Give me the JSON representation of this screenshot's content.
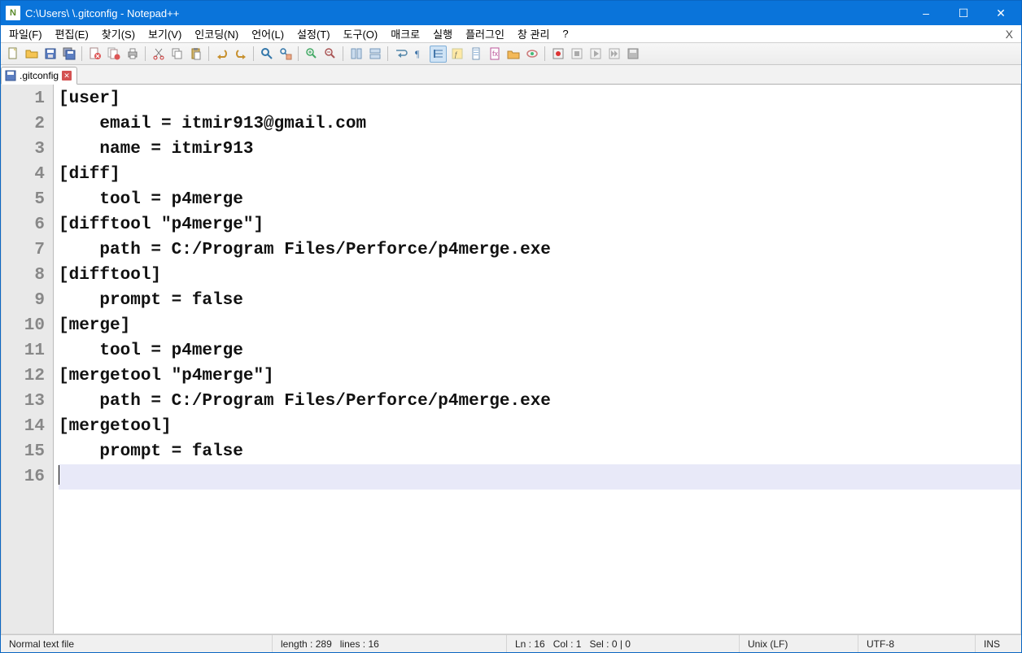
{
  "window": {
    "title": "C:\\Users\\          \\.gitconfig - Notepad++",
    "app_icon_letter": "N"
  },
  "win_controls": {
    "min": "–",
    "max": "☐",
    "close": "✕"
  },
  "menu": {
    "items": [
      "파일(F)",
      "편집(E)",
      "찾기(S)",
      "보기(V)",
      "인코딩(N)",
      "언어(L)",
      "설정(T)",
      "도구(O)",
      "매크로",
      "실행",
      "플러그인",
      "창 관리",
      "?"
    ],
    "close_x": "X"
  },
  "tab": {
    "filename": ".gitconfig"
  },
  "editor": {
    "lines": [
      "[user]",
      "    email = itmir913@gmail.com",
      "    name = itmir913",
      "[diff]",
      "    tool = p4merge",
      "[difftool \"p4merge\"]",
      "    path = C:/Program Files/Perforce/p4merge.exe",
      "[difftool]",
      "    prompt = false",
      "[merge]",
      "    tool = p4merge",
      "[mergetool \"p4merge\"]",
      "    path = C:/Program Files/Perforce/p4merge.exe",
      "[mergetool]",
      "    prompt = false",
      ""
    ],
    "current_line_index": 15
  },
  "status": {
    "filetype": "Normal text file",
    "length_label": "length :",
    "length_value": "289",
    "lines_label": "lines :",
    "lines_value": "16",
    "ln_label": "Ln :",
    "ln_value": "16",
    "col_label": "Col :",
    "col_value": "1",
    "sel_label": "Sel :",
    "sel_value": "0 | 0",
    "eol": "Unix (LF)",
    "encoding": "UTF-8",
    "insert_mode": "INS"
  }
}
